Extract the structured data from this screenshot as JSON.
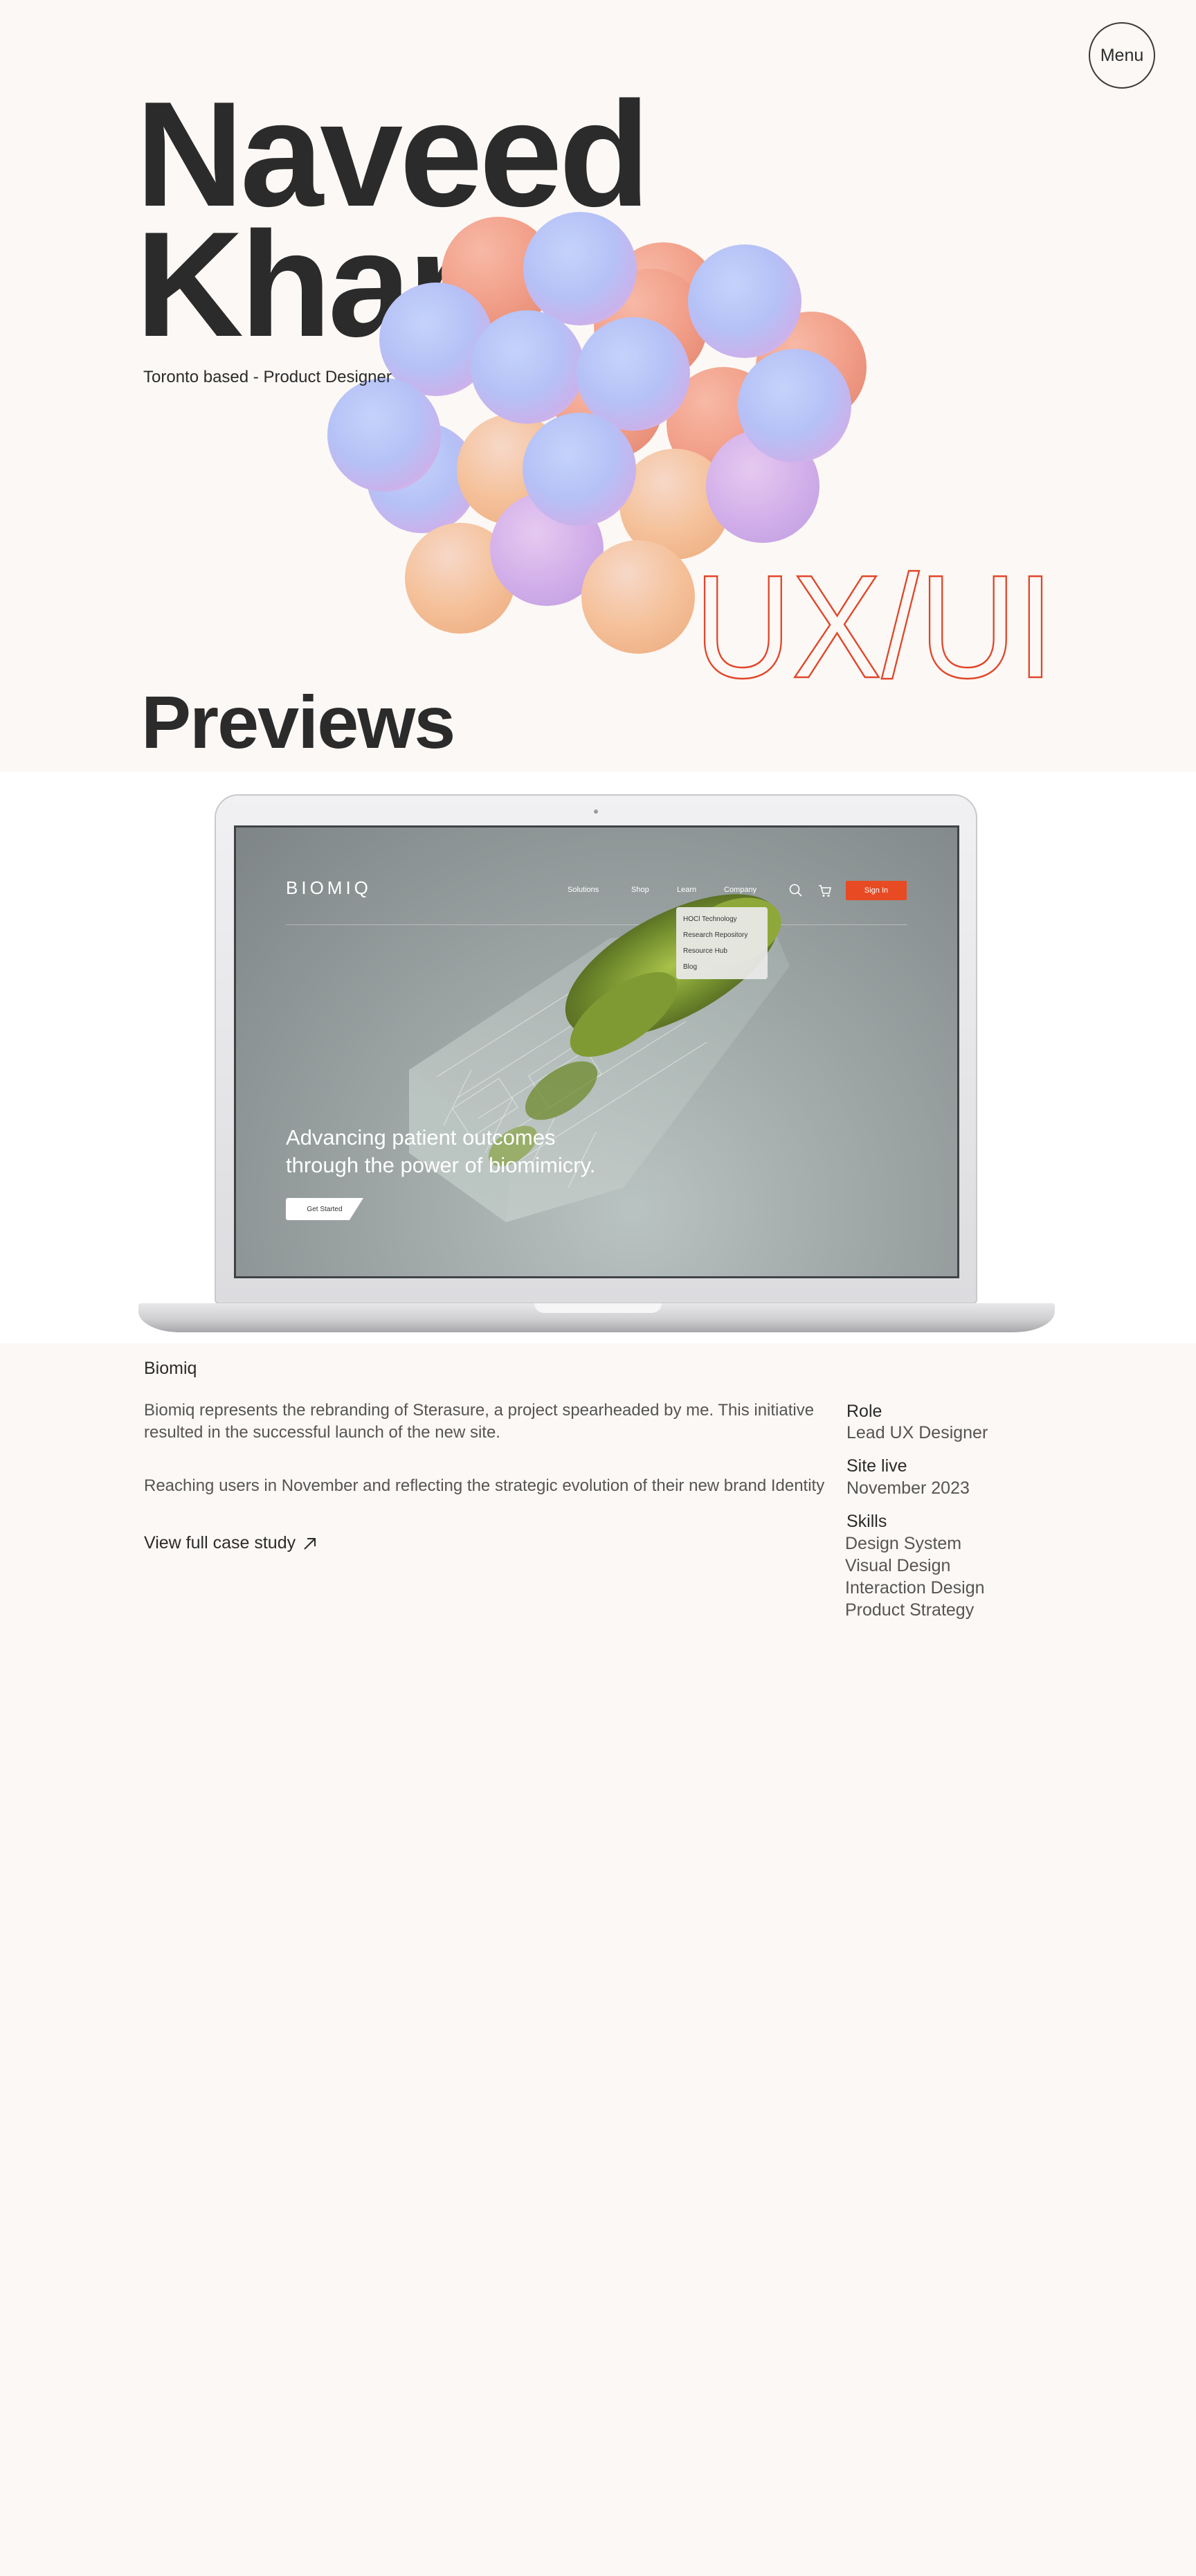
{
  "menu": {
    "label": "Menu"
  },
  "hero": {
    "name_line1": "Naveed",
    "name_line2": "Khan",
    "tagline": "Toronto based - Product Designer",
    "outline_text": "UX/UI",
    "outline_color": "#e0462a",
    "sphere_colors": [
      "#f2a48e",
      "#b9c4f6",
      "#f4c7a2",
      "#d6b2ea"
    ]
  },
  "previews": {
    "heading": "Previews"
  },
  "mockup": {
    "brand": "BIOMIQ",
    "nav": [
      "Solutions",
      "Shop",
      "Learn",
      "Company"
    ],
    "sign_in": "Sign In",
    "dropdown": [
      "HOCl Technology",
      "Research Repository",
      "Resource Hub",
      "Blog"
    ],
    "hero_line1": "Advancing patient outcomes",
    "hero_line2": "through the power of biomimicry.",
    "cta": "Get Started",
    "accent_color": "#e84b23"
  },
  "project": {
    "name": "Biomiq",
    "description1": "Biomiq represents the rebranding of Sterasure, a project spearheaded by me. This initiative resulted in the successful launch of the new site.",
    "description2": "Reaching users in November and reflecting the strategic evolution of their new brand Identity",
    "case_link": "View full case study",
    "role_label": "Role",
    "role_value": "Lead UX Designer",
    "site_label": "Site live",
    "site_value": "November 2023",
    "skills_label": "Skills",
    "skills": [
      "Design System",
      "Visual Design",
      "Interaction Design",
      "Product Strategy"
    ]
  }
}
